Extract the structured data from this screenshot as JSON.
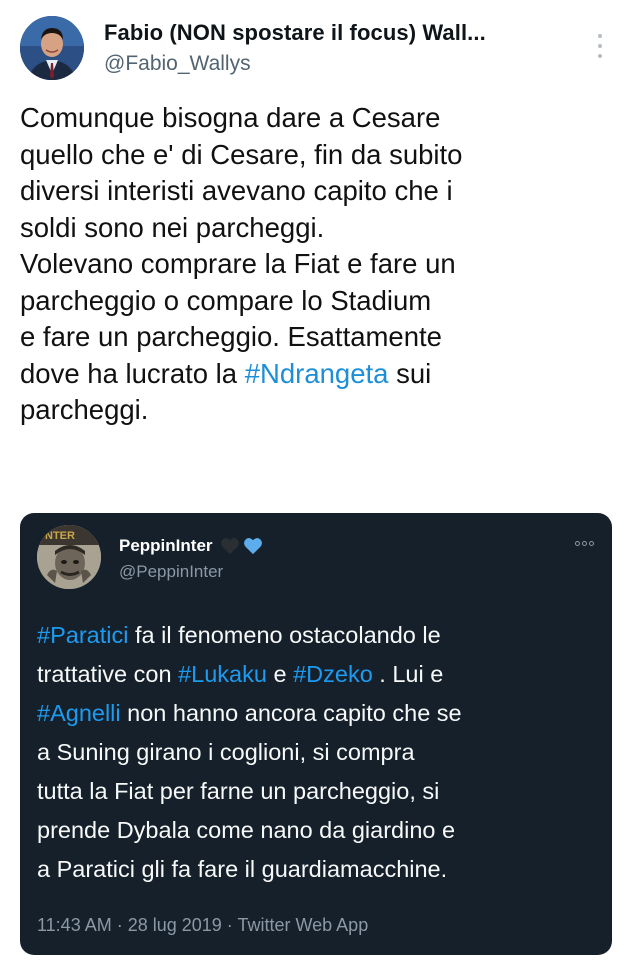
{
  "author": {
    "display_name": "Fabio (NON spostare il focus) Wall...",
    "handle": "@Fabio_Wallys"
  },
  "tweet": {
    "lines": [
      {
        "before": "Comunque bisogna dare a Cesare",
        "hashtag": "",
        "after": ""
      },
      {
        "before": "quello che e' di Cesare, fin da subito",
        "hashtag": "",
        "after": ""
      },
      {
        "before": "diversi interisti avevano capito che i",
        "hashtag": "",
        "after": ""
      },
      {
        "before": "soldi sono nei parcheggi.",
        "hashtag": "",
        "after": ""
      },
      {
        "before": "Volevano comprare la Fiat e fare un",
        "hashtag": "",
        "after": ""
      },
      {
        "before": "parcheggio o compare lo Stadium",
        "hashtag": "",
        "after": ""
      },
      {
        "before": "e fare un parcheggio. Esattamente",
        "hashtag": "",
        "after": ""
      },
      {
        "before": "dove ha lucrato la ",
        "hashtag": "#Ndrangeta",
        "after": " sui"
      },
      {
        "before": "parcheggi.",
        "hashtag": "",
        "after": ""
      }
    ]
  },
  "quoted": {
    "display_name": "PeppinInter",
    "hearts": [
      "black-heart-icon",
      "blue-heart-icon"
    ],
    "handle": "@PeppinInter",
    "avatar_text": "NTER",
    "lines": [
      [
        {
          "t": "#Paratici",
          "h": true
        },
        {
          "t": " fa il fenomeno ostacolando le",
          "h": false
        }
      ],
      [
        {
          "t": "trattative con ",
          "h": false
        },
        {
          "t": "#Lukaku",
          "h": true
        },
        {
          "t": " e ",
          "h": false
        },
        {
          "t": "#Dzeko",
          "h": true
        },
        {
          "t": " . Lui e",
          "h": false
        }
      ],
      [
        {
          "t": "#Agnelli",
          "h": true
        },
        {
          "t": " non hanno ancora capito che se",
          "h": false
        }
      ],
      [
        {
          "t": "a Suning girano i coglioni, si compra",
          "h": false
        }
      ],
      [
        {
          "t": "tutta la Fiat per farne un parcheggio, si",
          "h": false
        }
      ],
      [
        {
          "t": "prende Dybala come nano da giardino e",
          "h": false
        }
      ],
      [
        {
          "t": "a Paratici gli fa fare il guardiamacchine.",
          "h": false
        }
      ]
    ],
    "footer": "11:43 AM · 28 lug 2019 · Twitter Web App"
  },
  "colors": {
    "hashtag_light": "#1d8fd6",
    "hashtag_dark": "#1d9bf0",
    "card_bg": "#15202b",
    "muted_text": "#536471"
  }
}
